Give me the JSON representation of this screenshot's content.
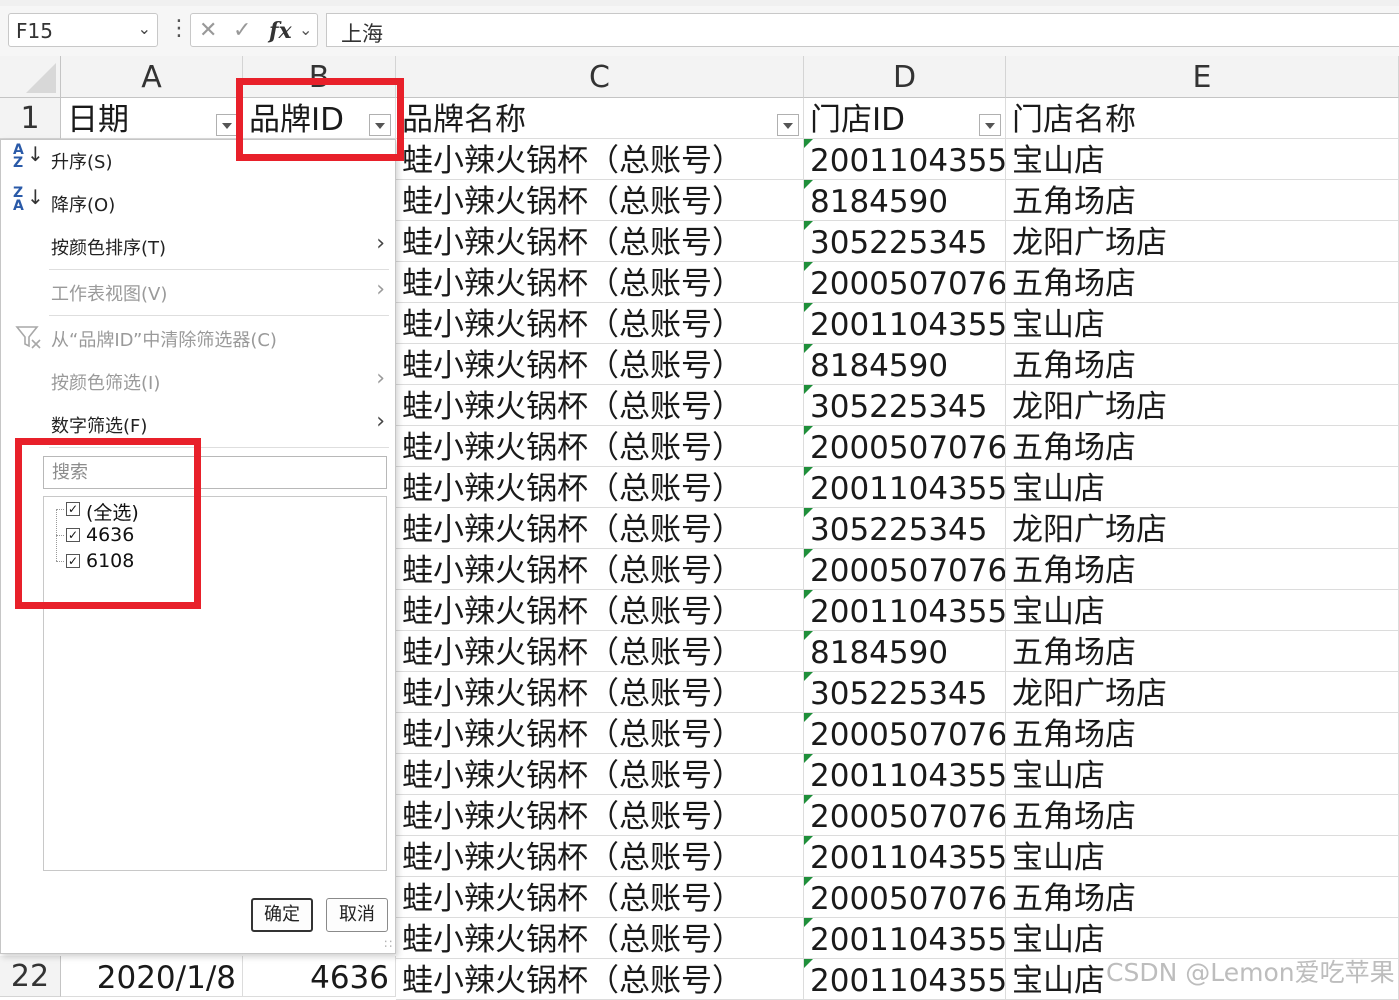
{
  "formula_bar": {
    "name_box": "F15",
    "fx_label": "fx",
    "content": "上海"
  },
  "columns": [
    {
      "letter": "A"
    },
    {
      "letter": "B"
    },
    {
      "letter": "C"
    },
    {
      "letter": "D"
    },
    {
      "letter": "E"
    }
  ],
  "headers": {
    "date": "日期",
    "brand_id": "品牌ID",
    "brand_name": "品牌名称",
    "store_id": "门店ID",
    "store_name": "门店名称"
  },
  "rows": [
    {
      "n": "1"
    },
    {
      "n": "22",
      "date": "2020/1/8",
      "brand_id": "4636"
    }
  ],
  "data_rows": [
    {
      "brand_name": "蛙小辣火锅杯（总账号）",
      "store_id": "2001104355",
      "store_name": "宝山店"
    },
    {
      "brand_name": "蛙小辣火锅杯（总账号）",
      "store_id": "8184590",
      "store_name": "五角场店"
    },
    {
      "brand_name": "蛙小辣火锅杯（总账号）",
      "store_id": "305225345",
      "store_name": "龙阳广场店"
    },
    {
      "brand_name": "蛙小辣火锅杯（总账号）",
      "store_id": "2000507076",
      "store_name": "五角场店"
    },
    {
      "brand_name": "蛙小辣火锅杯（总账号）",
      "store_id": "2001104355",
      "store_name": "宝山店"
    },
    {
      "brand_name": "蛙小辣火锅杯（总账号）",
      "store_id": "8184590",
      "store_name": "五角场店"
    },
    {
      "brand_name": "蛙小辣火锅杯（总账号）",
      "store_id": "305225345",
      "store_name": "龙阳广场店"
    },
    {
      "brand_name": "蛙小辣火锅杯（总账号）",
      "store_id": "2000507076",
      "store_name": "五角场店"
    },
    {
      "brand_name": "蛙小辣火锅杯（总账号）",
      "store_id": "2001104355",
      "store_name": "宝山店"
    },
    {
      "brand_name": "蛙小辣火锅杯（总账号）",
      "store_id": "305225345",
      "store_name": "龙阳广场店"
    },
    {
      "brand_name": "蛙小辣火锅杯（总账号）",
      "store_id": "2000507076",
      "store_name": "五角场店"
    },
    {
      "brand_name": "蛙小辣火锅杯（总账号）",
      "store_id": "2001104355",
      "store_name": "宝山店"
    },
    {
      "brand_name": "蛙小辣火锅杯（总账号）",
      "store_id": "8184590",
      "store_name": "五角场店"
    },
    {
      "brand_name": "蛙小辣火锅杯（总账号）",
      "store_id": "305225345",
      "store_name": "龙阳广场店"
    },
    {
      "brand_name": "蛙小辣火锅杯（总账号）",
      "store_id": "2000507076",
      "store_name": "五角场店"
    },
    {
      "brand_name": "蛙小辣火锅杯（总账号）",
      "store_id": "2001104355",
      "store_name": "宝山店"
    },
    {
      "brand_name": "蛙小辣火锅杯（总账号）",
      "store_id": "2000507076",
      "store_name": "五角场店"
    },
    {
      "brand_name": "蛙小辣火锅杯（总账号）",
      "store_id": "2001104355",
      "store_name": "宝山店"
    },
    {
      "brand_name": "蛙小辣火锅杯（总账号）",
      "store_id": "2000507076",
      "store_name": "五角场店"
    },
    {
      "brand_name": "蛙小辣火锅杯（总账号）",
      "store_id": "2001104355",
      "store_name": "宝山店"
    },
    {
      "brand_name": "蛙小辣火锅杯（总账号）",
      "store_id": "2001104355",
      "store_name": "宝山店"
    }
  ],
  "filter_menu": {
    "sort_asc": "升序(S)",
    "sort_desc": "降序(O)",
    "sort_by_color": "按颜色排序(T)",
    "sheet_view": "工作表视图(V)",
    "clear_filter": "从“品牌ID”中清除筛选器(C)",
    "filter_by_color": "按颜色筛选(I)",
    "number_filter": "数字筛选(F)",
    "search_placeholder": "搜索",
    "items": [
      "(全选)",
      "4636",
      "6108"
    ],
    "ok": "确定",
    "cancel": "取消"
  },
  "icons": {
    "sort_asc": "sort-asc-icon",
    "sort_desc": "sort-desc-icon",
    "clear_filter": "funnel-clear-icon",
    "submenu": "chevron-right-icon",
    "name_box_dropdown": "chevron-down-icon"
  },
  "colors": {
    "highlight": "#e8202a",
    "error_triangle": "#1f8f3a"
  },
  "watermark": "CSDN @Lemon爱吃苹果"
}
